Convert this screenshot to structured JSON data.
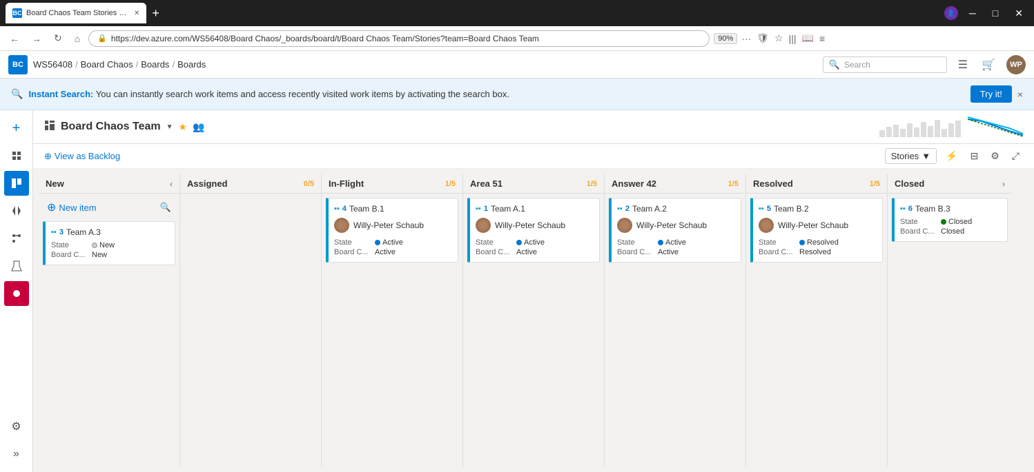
{
  "browser": {
    "tab_title": "Board Chaos Team Stories Boa...",
    "tab_favicon": "BC",
    "url": "https://dev.azure.com/WS56408/Board Chaos/_boards/board/t/Board Chaos Team/Stories?team=Board Chaos Team",
    "zoom": "90%",
    "new_tab_label": "+"
  },
  "topnav": {
    "org": "WS56408",
    "project": "Board Chaos",
    "nav1": "Boards",
    "nav2": "Boards",
    "search_placeholder": "Search",
    "azure_logo": "BC"
  },
  "banner": {
    "icon": "🔍",
    "bold_text": "Instant Search:",
    "message": " You can instantly search work items and access recently visited work items by activating the search box.",
    "try_it_label": "Try it!",
    "close_label": "×"
  },
  "board": {
    "title": "Board Chaos Team",
    "view_backlog_label": "View as Backlog",
    "stories_label": "Stories",
    "columns": [
      {
        "id": "new",
        "title": "New",
        "count": "",
        "collapsed": false,
        "has_new_item": true,
        "cards": [
          {
            "id": "3",
            "title": "Team A.3",
            "type_icon": "▪▪",
            "assignee": "",
            "state": "New",
            "state_dot": "new",
            "board_column": "New"
          }
        ]
      },
      {
        "id": "assigned",
        "title": "Assigned",
        "count": "0/5",
        "collapsed": false,
        "has_new_item": false,
        "cards": []
      },
      {
        "id": "in-flight",
        "title": "In-Flight",
        "count": "1/5",
        "collapsed": false,
        "has_new_item": false,
        "cards": [
          {
            "id": "4",
            "title": "Team B.1",
            "type_icon": "▪▪",
            "assignee": "Willy-Peter Schaub",
            "state": "Active",
            "state_dot": "active",
            "board_column": "Active"
          }
        ]
      },
      {
        "id": "area51",
        "title": "Area 51",
        "count": "1/5",
        "collapsed": false,
        "has_new_item": false,
        "cards": [
          {
            "id": "1",
            "title": "Team A.1",
            "type_icon": "▪▪",
            "assignee": "Willy-Peter Schaub",
            "state": "Active",
            "state_dot": "active",
            "board_column": "Active"
          }
        ]
      },
      {
        "id": "answer42",
        "title": "Answer 42",
        "count": "1/5",
        "collapsed": false,
        "has_new_item": false,
        "cards": [
          {
            "id": "2",
            "title": "Team A.2",
            "type_icon": "▪▪",
            "assignee": "Willy-Peter Schaub",
            "state": "Active",
            "state_dot": "active",
            "board_column": "Active"
          }
        ]
      },
      {
        "id": "resolved",
        "title": "Resolved",
        "count": "1/5",
        "collapsed": false,
        "has_new_item": false,
        "cards": [
          {
            "id": "5",
            "title": "Team B.2",
            "type_icon": "▪▪",
            "assignee": "Willy-Peter Schaub",
            "state": "Resolved",
            "state_dot": "resolved",
            "board_column": "Resolved"
          }
        ]
      },
      {
        "id": "closed",
        "title": "Closed",
        "count": "",
        "collapsed": true,
        "has_new_item": false,
        "cards": [
          {
            "id": "6",
            "title": "Team B.3",
            "type_icon": "▪▪",
            "assignee": "",
            "state": "Closed",
            "state_dot": "closed",
            "board_column": "Closed"
          }
        ]
      }
    ]
  },
  "sidebar": {
    "icons": [
      {
        "name": "overview",
        "symbol": "🏠",
        "active": false
      },
      {
        "name": "boards",
        "symbol": "📋",
        "active": true
      },
      {
        "name": "repos",
        "symbol": "📁",
        "active": false
      },
      {
        "name": "pipelines",
        "symbol": "⚡",
        "active": false
      },
      {
        "name": "test",
        "symbol": "🧪",
        "active": false
      },
      {
        "name": "artifacts",
        "symbol": "📦",
        "active": false
      }
    ]
  },
  "labels": {
    "new_item": "New item",
    "state": "State",
    "board_col": "Board C...",
    "add_icon": "+",
    "view_backlog_plus": "⊕"
  }
}
